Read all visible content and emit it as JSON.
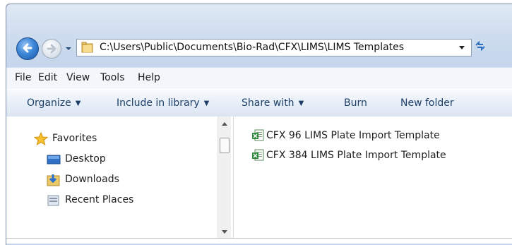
{
  "address": {
    "path": "C:\\Users\\Public\\Documents\\Bio-Rad\\CFX\\LIMS\\LIMS Templates"
  },
  "menu": [
    "File",
    "Edit",
    "View",
    "Tools",
    "Help"
  ],
  "toolbar": {
    "organize": "Organize",
    "include_in_library": "Include in library",
    "share_with": "Share with",
    "burn": "Burn",
    "new_folder": "New folder"
  },
  "nav": {
    "favorites": "Favorites",
    "desktop": "Desktop",
    "downloads": "Downloads",
    "recent_places": "Recent Places"
  },
  "files": [
    {
      "name": "CFX 96 LIMS Plate Import Template",
      "icon": "excel-icon"
    },
    {
      "name": "CFX 384 LIMS Plate Import Template",
      "icon": "excel-icon"
    }
  ],
  "icons": {
    "back": "back-arrow-icon",
    "forward": "forward-arrow-icon",
    "folder": "folder-icon",
    "refresh": "refresh-icon",
    "favorites": "star-icon",
    "desktop": "desktop-icon",
    "downloads": "downloads-folder-icon",
    "recent_places": "recent-places-icon"
  },
  "colors": {
    "chrome_top": "#dfe9f5",
    "chrome_bottom": "#c3d5eb",
    "toolbar_text": "#1e3f67",
    "back_button": "#3d86d8"
  }
}
